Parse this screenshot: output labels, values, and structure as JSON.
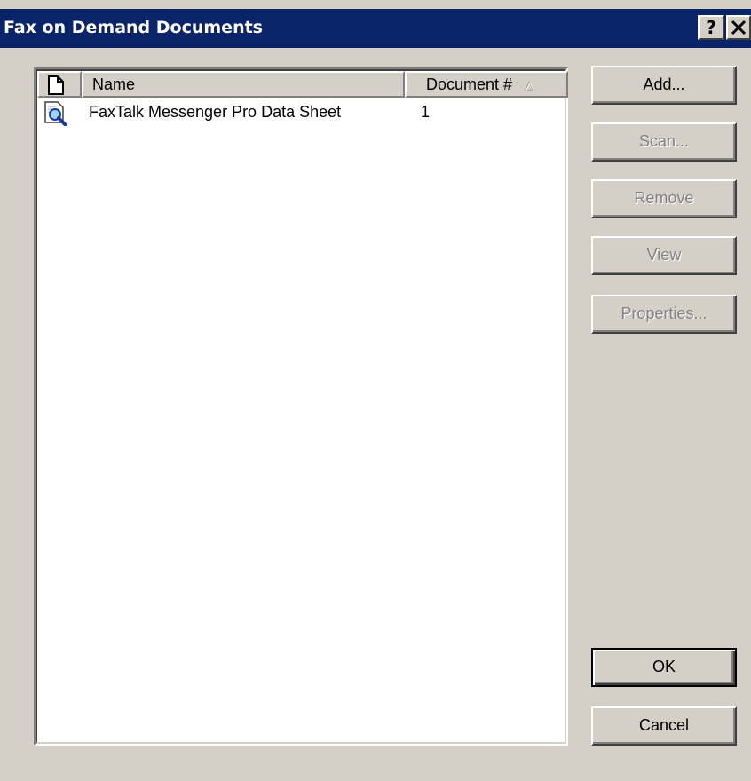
{
  "window": {
    "title": "Fax on Demand Documents",
    "help_label": "?",
    "close_label": "✕"
  },
  "list": {
    "columns": {
      "name": "Name",
      "document_number": "Document #"
    },
    "sort_indicator": "△",
    "rows": [
      {
        "name": "FaxTalk Messenger Pro Data Sheet",
        "document_number": "1",
        "icon": "document-preview-icon"
      }
    ]
  },
  "buttons": {
    "add": "Add...",
    "scan": "Scan...",
    "remove": "Remove",
    "view": "View",
    "properties": "Properties...",
    "ok": "OK",
    "cancel": "Cancel"
  },
  "colors": {
    "titlebar": "#0a246a",
    "face": "#d4d0c8",
    "disabled_text": "#808080"
  }
}
